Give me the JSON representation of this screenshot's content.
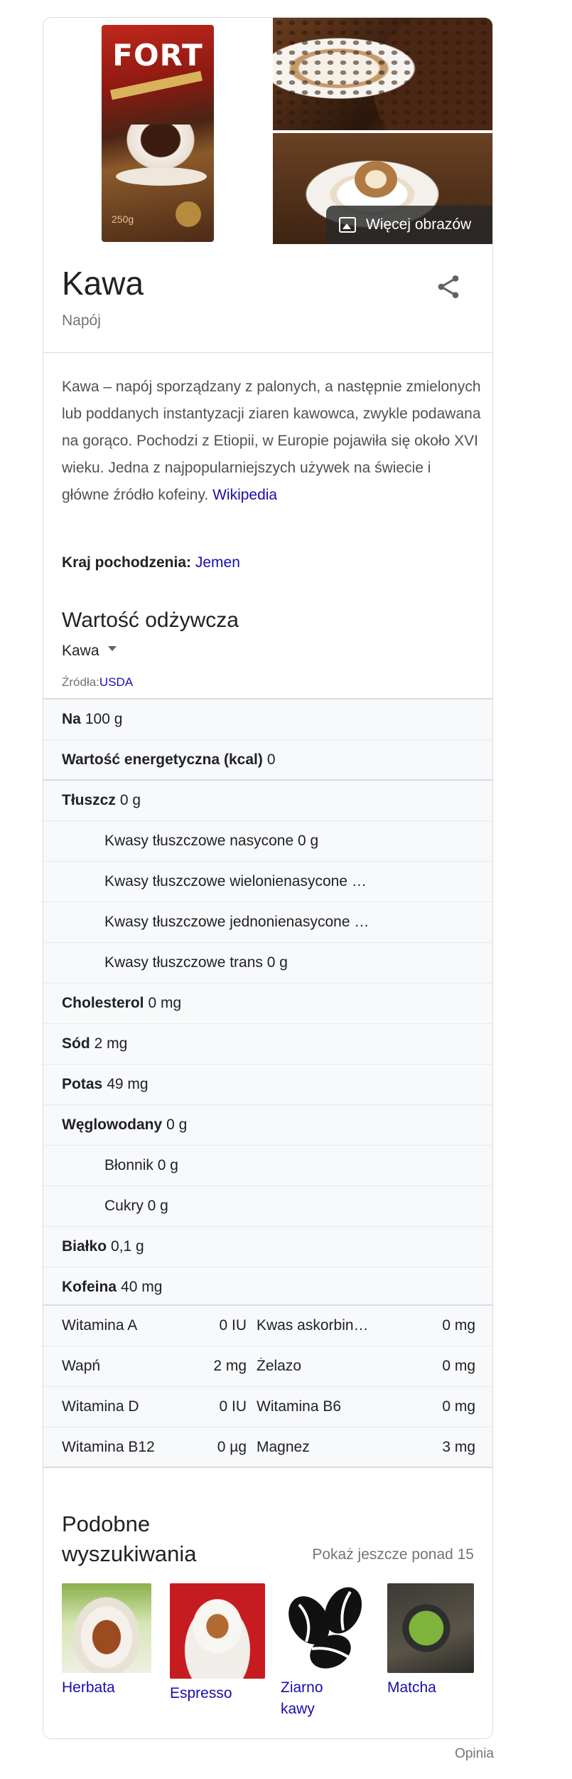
{
  "images": {
    "more_images_label": "Więcej obrazów",
    "pack_brand": "FORT",
    "pack_weight": "250g"
  },
  "entity": {
    "title": "Kawa",
    "subtitle": "Napój"
  },
  "description": {
    "text": "Kawa – napój sporządzany z palonych, a następnie zmielonych lub poddanych instantyzacji ziaren kawowca, zwykle podawana na gorąco. Pochodzi z Etiopii, w Europie pojawiła się około XVI wieku. Jedna z najpopularniejszych używek na świecie i główne źródło kofeiny.",
    "source_link": "Wikipedia"
  },
  "origin": {
    "label": "Kraj pochodzenia:",
    "value": "Jemen"
  },
  "nutrition": {
    "title": "Wartość odżywcza",
    "selected_food": "Kawa",
    "sources_label": "Źródła:",
    "sources_link": "USDA",
    "rows": [
      {
        "label": "Na",
        "value": "100 g"
      },
      {
        "label": "Wartość energetyczna (kcal)",
        "value": "0"
      },
      {
        "label": "Tłuszcz",
        "value": "0 g"
      },
      {
        "label": "",
        "value": "Kwasy tłuszczowe nasycone 0 g"
      },
      {
        "label": "",
        "value": "Kwasy tłuszczowe wielonienasycone …"
      },
      {
        "label": "",
        "value": "Kwasy tłuszczowe jednonienasycone …"
      },
      {
        "label": "",
        "value": "Kwasy tłuszczowe trans 0 g"
      },
      {
        "label": "Cholesterol",
        "value": "0 mg"
      },
      {
        "label": "Sód",
        "value": "2 mg"
      },
      {
        "label": "Potas",
        "value": "49 mg"
      },
      {
        "label": "Węglowodany",
        "value": "0 g"
      },
      {
        "label": "",
        "value": "Błonnik 0 g"
      },
      {
        "label": "",
        "value": "Cukry 0 g"
      },
      {
        "label": "Białko",
        "value": "0,1 g"
      },
      {
        "label": "Kofeina",
        "value": "40 mg"
      }
    ],
    "vitamins": [
      {
        "l_name": "Witamina A",
        "l_val": "0 IU",
        "r_name": "Kwas askorbin…",
        "r_val": "0 mg"
      },
      {
        "l_name": "Wapń",
        "l_val": "2 mg",
        "r_name": "Żelazo",
        "r_val": "0 mg"
      },
      {
        "l_name": "Witamina D",
        "l_val": "0 IU",
        "r_name": "Witamina B6",
        "r_val": "0 mg"
      },
      {
        "l_name": "Witamina B12",
        "l_val": "0 µg",
        "r_name": "Magnez",
        "r_val": "3 mg"
      }
    ]
  },
  "related": {
    "title": "Podobne wyszukiwania",
    "more_label": "Pokaż jeszcze ponad 15",
    "items": [
      {
        "label": "Herbata"
      },
      {
        "label": "Espresso"
      },
      {
        "label": "Ziarno kawy"
      },
      {
        "label": "Matcha"
      }
    ]
  },
  "footer": {
    "feedback": "Opinia"
  }
}
